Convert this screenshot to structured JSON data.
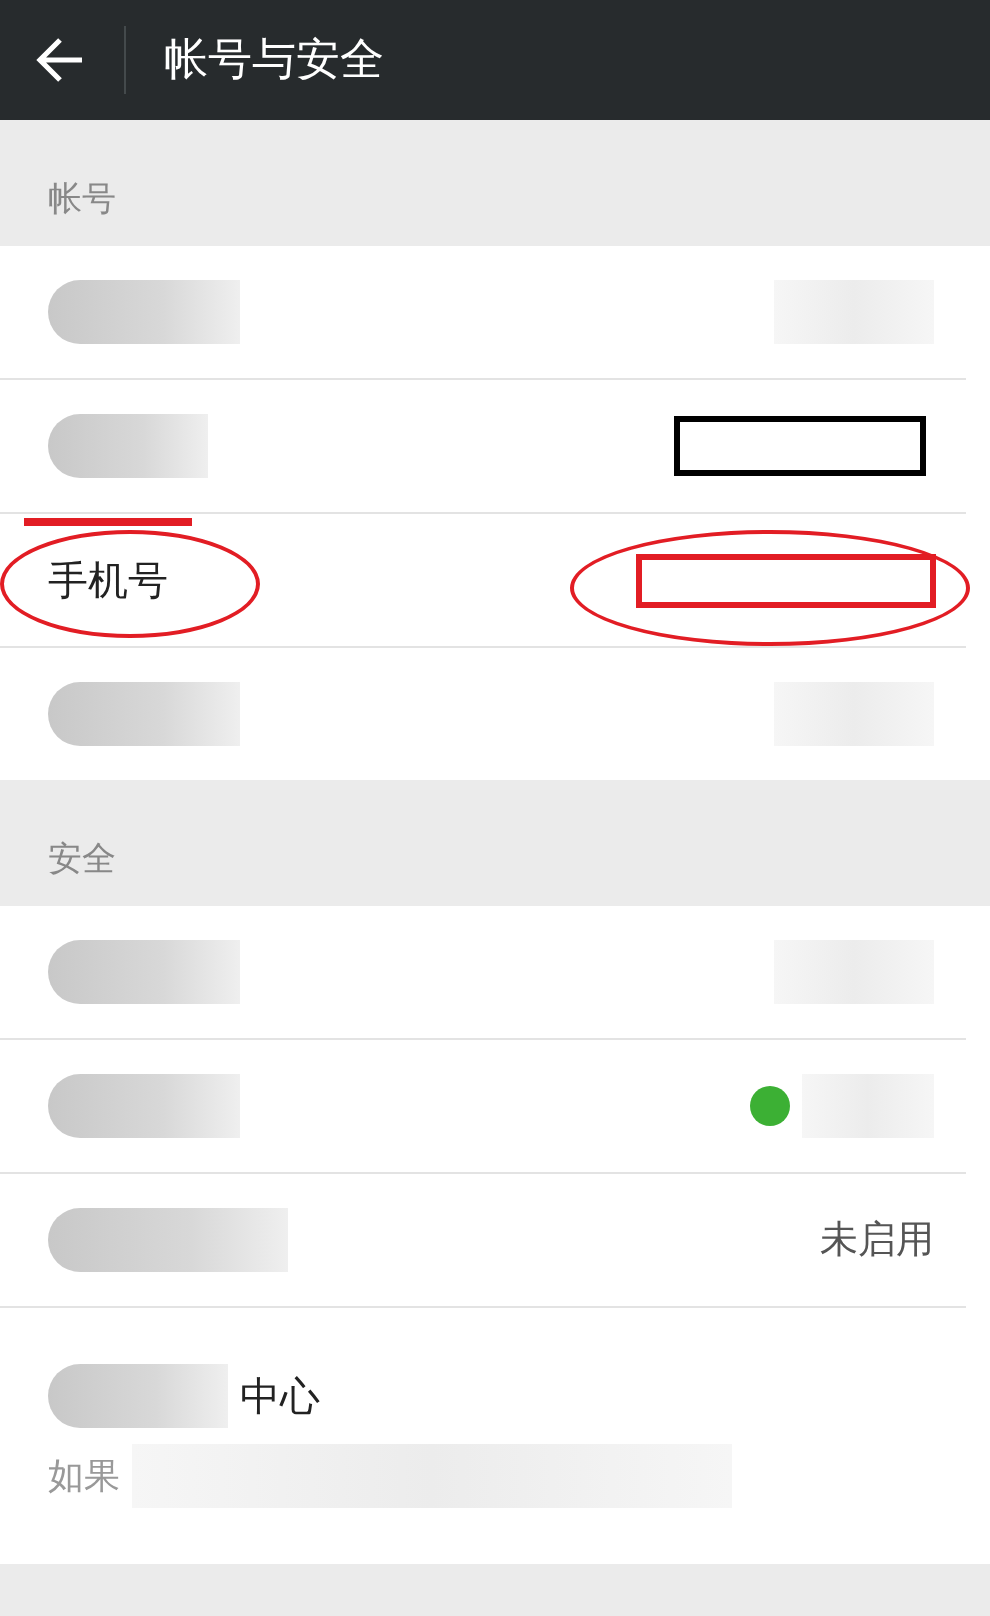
{
  "header": {
    "title": "帐号与安全"
  },
  "sections": [
    {
      "title": "帐号",
      "rows": [
        {
          "kind": "blurred"
        },
        {
          "kind": "boxed"
        },
        {
          "kind": "circled",
          "label": "手机号"
        },
        {
          "kind": "blurred"
        }
      ]
    },
    {
      "title": "安全",
      "rows": [
        {
          "kind": "blurred"
        },
        {
          "kind": "badge",
          "color": "#3cb034"
        },
        {
          "kind": "value",
          "value": "未启用"
        },
        {
          "kind": "note",
          "label": "中心",
          "note": "如果"
        }
      ]
    }
  ]
}
